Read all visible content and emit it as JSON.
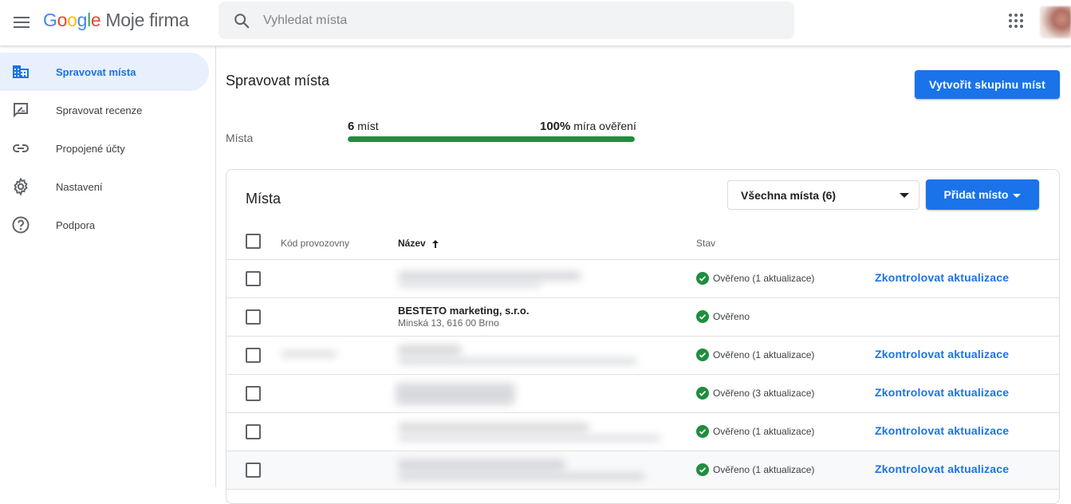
{
  "header": {
    "logo_letters": [
      "G",
      "o",
      "o",
      "g",
      "l",
      "e"
    ],
    "product_name": "Moje firma",
    "search_placeholder": "Vyhledat místa"
  },
  "sidebar": {
    "items": [
      {
        "label": "Spravovat místa",
        "icon": "building-icon",
        "active": true
      },
      {
        "label": "Spravovat recenze",
        "icon": "review-icon",
        "active": false
      },
      {
        "label": "Propojené účty",
        "icon": "link-icon",
        "active": false
      },
      {
        "label": "Nastavení",
        "icon": "gear-icon",
        "active": false
      },
      {
        "label": "Podpora",
        "icon": "help-icon",
        "active": false
      }
    ]
  },
  "main": {
    "title": "Spravovat místa",
    "create_group_label": "Vytvořit skupinu míst",
    "stats": {
      "label": "Místa",
      "count_value": "6",
      "count_suffix": "míst",
      "rate_value": "100%",
      "rate_suffix": "míra ověření",
      "progress_fraction": 1.0
    }
  },
  "card": {
    "title": "Místa",
    "filter_selected": "Všechna místa (6)",
    "add_label": "Přidat místo",
    "columns": {
      "code": "Kód provozovny",
      "name": "Název",
      "status": "Stav"
    },
    "rows": [
      {
        "name": "",
        "address": "",
        "status": "Ověřeno (1 aktualizace)",
        "action": "Zkontrolovat aktualizace",
        "blurred": true
      },
      {
        "name": "BESTETO marketing, s.r.o.",
        "address": "Minská 13, 616 00 Brno",
        "status": "Ověřeno",
        "action": "",
        "blurred": false
      },
      {
        "name": "",
        "address": "",
        "status": "Ověřeno (1 aktualizace)",
        "action": "Zkontrolovat aktualizace",
        "blurred": true
      },
      {
        "name": "",
        "address": "",
        "status": "Ověřeno (3 aktualizace)",
        "action": "Zkontrolovat aktualizace",
        "blurred": true
      },
      {
        "name": "",
        "address": "",
        "status": "Ověřeno (1 aktualizace)",
        "action": "Zkontrolovat aktualizace",
        "blurred": true
      },
      {
        "name": "",
        "address": "",
        "status": "Ověřeno (1 aktualizace)",
        "action": "Zkontrolovat aktualizace",
        "blurred": true
      }
    ]
  },
  "colors": {
    "accent": "#1a73e8",
    "verified_green": "#1e8e3e",
    "active_nav_bg": "#e8f0fe"
  }
}
